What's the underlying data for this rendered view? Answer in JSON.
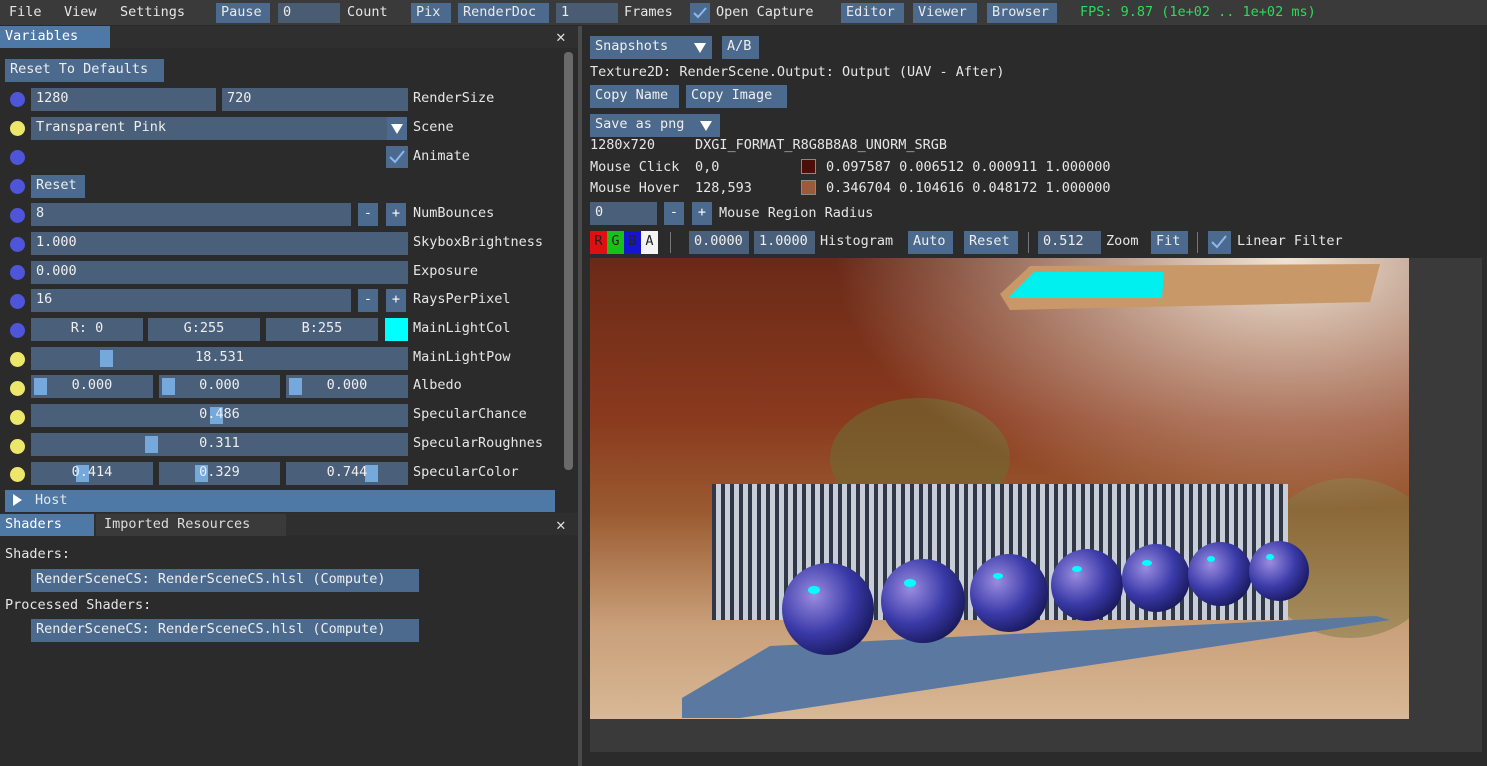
{
  "menu": {
    "file": "File",
    "view": "View",
    "settings": "Settings",
    "pause": "Pause",
    "frame_count": "0",
    "count": "Count",
    "pix": "Pix",
    "renderdoc": "RenderDoc",
    "renderdoc_frames_value": "1",
    "frames": "Frames",
    "open_capture": "Open Capture",
    "editor": "Editor",
    "viewer": "Viewer",
    "browser": "Browser",
    "fps": "FPS: 9.87 (1e+02 .. 1e+02 ms)"
  },
  "variables": {
    "tab": "Variables",
    "reset_defaults": "Reset To Defaults",
    "render_w": "1280",
    "render_h": "720",
    "render_size": "RenderSize",
    "scene_value": "Transparent Pink",
    "scene": "Scene",
    "animate": "Animate",
    "reset": "Reset",
    "num_bounces_val": "8",
    "num_bounces": "NumBounces",
    "skybox_val": "1.000",
    "skybox": "SkyboxBrightness",
    "exposure_val": "0.000",
    "exposure": "Exposure",
    "rays_val": "16",
    "rays": "RaysPerPixel",
    "col_r": "R:  0",
    "col_g": "G:255",
    "col_b": "B:255",
    "main_light_col": "MainLightCol",
    "main_light_pow_val": "18.531",
    "main_light_pow": "MainLightPow",
    "albedo_r": "0.000",
    "albedo_g": "0.000",
    "albedo_b": "0.000",
    "albedo": "Albedo",
    "spec_chance_val": "0.486",
    "spec_chance": "SpecularChance",
    "spec_rough_val": "0.311",
    "spec_rough": "SpecularRoughnes",
    "spec_c_r": "0.414",
    "spec_c_g": "0.329",
    "spec_c_b": "0.744",
    "spec_color": "SpecularColor",
    "host": "Host",
    "minus": "-",
    "plus": "+",
    "main_light_color": "#00ffff"
  },
  "shaders": {
    "tab_shaders": "Shaders",
    "tab_imported": "Imported Resources",
    "shaders_label": "Shaders:",
    "shader1": "RenderSceneCS: RenderSceneCS.hlsl (Compute)",
    "processed_label": "Processed Shaders:",
    "shader2": "RenderSceneCS: RenderSceneCS.hlsl (Compute)"
  },
  "viewer": {
    "snapshots": "Snapshots",
    "ab": "A/B",
    "texture_info": "Texture2D: RenderScene.Output: Output (UAV - After)",
    "copy_name": "Copy Name",
    "copy_image": "Copy Image",
    "save_as": "Save as png",
    "resolution": "1280x720",
    "format": "DXGI_FORMAT_R8G8B8A8_UNORM_SRGB",
    "mouse_click": "Mouse Click",
    "click_pos": "0,0",
    "click_values": "0.097587 0.006512 0.000911 1.000000",
    "click_color": "#4a1008",
    "mouse_hover": "Mouse Hover",
    "hover_pos": "128,593",
    "hover_values": "0.346704 0.104616 0.048172 1.000000",
    "hover_color": "#9c5a3c",
    "radius_val": "0",
    "mouse_region_radius": "Mouse Region Radius",
    "ch_r": "R",
    "ch_g": "G",
    "ch_b": "B",
    "ch_a": "A",
    "hist_min": "0.0000",
    "hist_max": "1.0000",
    "histogram": "Histogram",
    "auto": "Auto",
    "reset": "Reset",
    "zoom_val": "0.512",
    "zoom": "Zoom",
    "fit": "Fit",
    "linear_filter": "Linear Filter"
  }
}
